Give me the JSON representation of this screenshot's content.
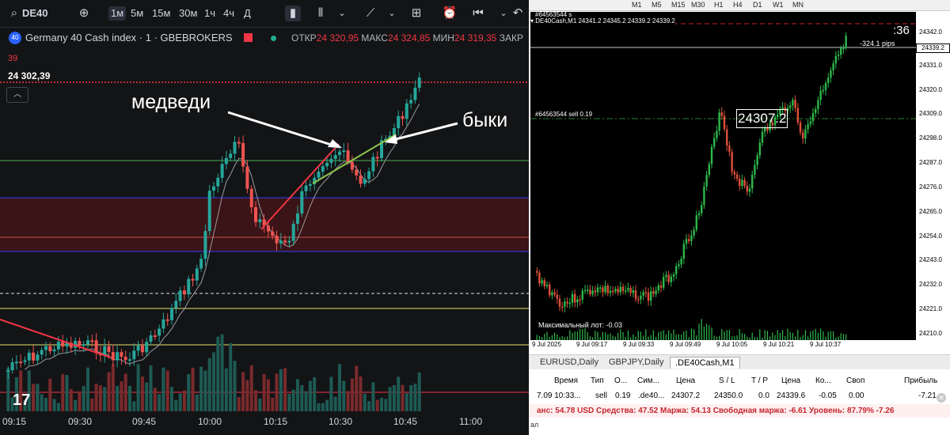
{
  "left": {
    "toolbar": {
      "symbol": "DE40",
      "timeframes": [
        "1м",
        "5м",
        "15м",
        "30м",
        "1ч",
        "4ч",
        "Д"
      ],
      "active_timeframe": "1м"
    },
    "info": {
      "badge": "40",
      "title": "Germany 40 Cash index · 1 · GBEBROKERS",
      "open_label": "ОТКР",
      "open_value": "24 320,95",
      "high_label": "МАКС",
      "high_value": "24 324,85",
      "low_label": "МИН",
      "low_value": "24 319,35",
      "close_label": "ЗАКР",
      "volume_value": "39",
      "price_value": "24 302,39"
    },
    "annotations": {
      "bears": "медведи",
      "bulls": "быки"
    },
    "xaxis_ticks": [
      "09:15",
      "09:30",
      "09:45",
      "10:00",
      "10:15",
      "10:30",
      "10:45",
      "11:00"
    ]
  },
  "right": {
    "timeframes": [
      "M1",
      "M5",
      "M15",
      "M30",
      "H1",
      "H4",
      "D1",
      "W1",
      "MN"
    ],
    "header_text": "▾.DE40Cash,M1  24341.2 24345.2 24339.2 24339.2",
    "order_id_top": "#64563544 s",
    "countdown": ":36",
    "pips_label": "-324.1 pips",
    "current_price": "24339.2",
    "order_line_label": "#64563544 sell 0.19",
    "price_box": "24307.2",
    "max_lot": "Максимальный лот: -0.03",
    "yaxis_ticks": [
      "24342.0",
      "24331.0",
      "24320.0",
      "24309.0",
      "24298.0",
      "24287.0",
      "24276.0",
      "24265.0",
      "24254.0",
      "24243.0",
      "24232.0",
      "24221.0",
      "24210.0"
    ],
    "xaxis_ticks": [
      "9 Jul 2025",
      "9 Jul 09:17",
      "9 Jul 09:33",
      "9 Jul 09:49",
      "9 Jul 10:05",
      "9 Jul 10:21",
      "9 Jul 10:37"
    ],
    "tabs": [
      "EURUSD,Daily",
      "GBPJPY,Daily",
      ".DE40Cash,M1"
    ],
    "active_tab": ".DE40Cash,M1",
    "table": {
      "headers": [
        "Время",
        "Тип",
        "О...",
        "Сим...",
        "Цена",
        "S / L",
        "T / P",
        "Цена",
        "Ко...",
        "Своп",
        "Прибыль"
      ],
      "row": [
        "7.09 10:33...",
        "sell",
        "0.19",
        ".de40...",
        "24307.2",
        "24350.0",
        "0.0",
        "24339.6",
        "-0.05",
        "0.00",
        "-7.21"
      ]
    },
    "balance_line": "анс: 54.78 USD  Средства: 47.52  Маржа: 54.13  Свободная маржа: -6.61  Уровень: 87.79% -7.26",
    "side_label": "ал"
  }
}
